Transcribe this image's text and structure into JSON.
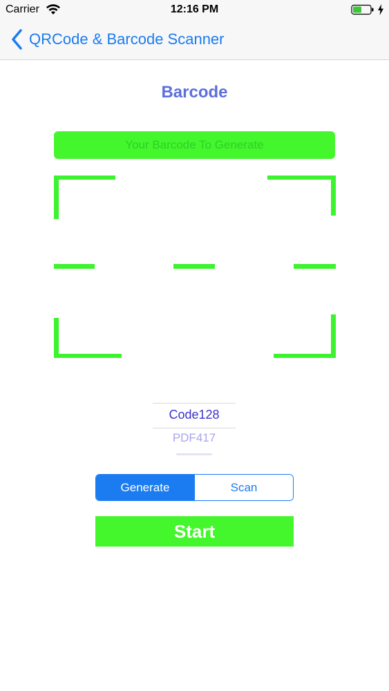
{
  "status_bar": {
    "carrier": "Carrier",
    "time": "12:16 PM",
    "icons": [
      "wifi-icon",
      "battery-icon",
      "charging-bolt-icon"
    ]
  },
  "nav": {
    "back_label": "QRCode & Barcode Scanner",
    "back_icon": "chevron-left-icon"
  },
  "page": {
    "title": "Barcode"
  },
  "input": {
    "value": "",
    "placeholder": "Your Barcode To Generate"
  },
  "picker": {
    "selected": "Code128",
    "next": "PDF417"
  },
  "segmented": {
    "options": [
      "Generate",
      "Scan"
    ],
    "selected": "Generate"
  },
  "start_button": {
    "label": "Start"
  },
  "colors": {
    "accent_blue": "#1a7cf0",
    "title_purple": "#5c6fdc",
    "scanner_green": "#3df22f",
    "button_green": "#44f62c",
    "picker_selected": "#3b34c9",
    "picker_faded": "#a8a5ec"
  }
}
